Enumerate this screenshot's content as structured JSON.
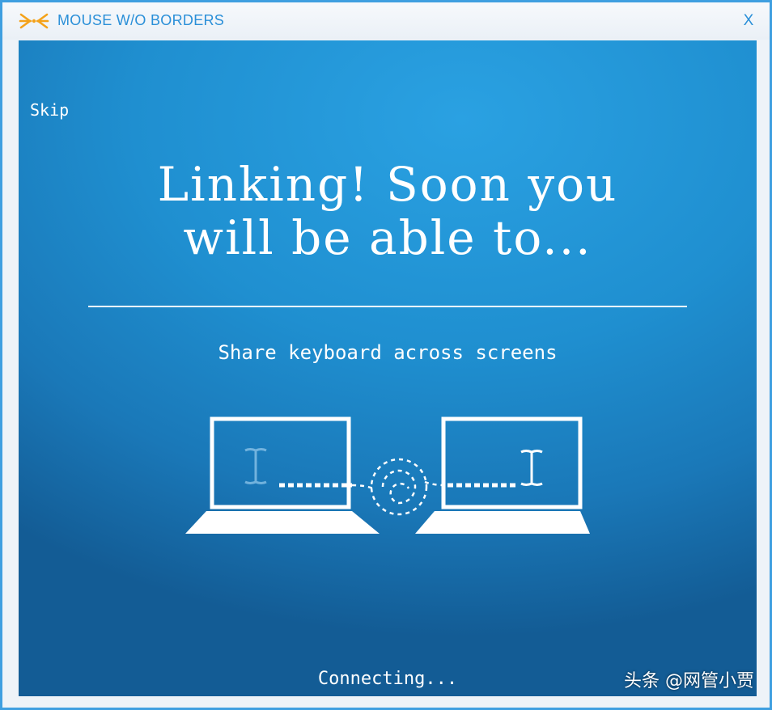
{
  "window": {
    "title": "MOUSE W/O BORDERS",
    "close_label": "X",
    "logo_icon": "arrows-converging-logo",
    "accent_color": "#2a8fd8",
    "background_color": "#1f8fd0"
  },
  "skip_label": "Skip",
  "headline": {
    "line1": "Linking! Soon you",
    "line2": "will be able to..."
  },
  "feature_caption": "Share keyboard across screens",
  "illustration": {
    "left_icon": "laptop-icon",
    "right_icon": "laptop-icon",
    "center_icon": "swirl-link-icon",
    "cursor_icon": "text-cursor-icon"
  },
  "status_text": "Connecting...",
  "watermark_text": "头条 @网管小贾"
}
